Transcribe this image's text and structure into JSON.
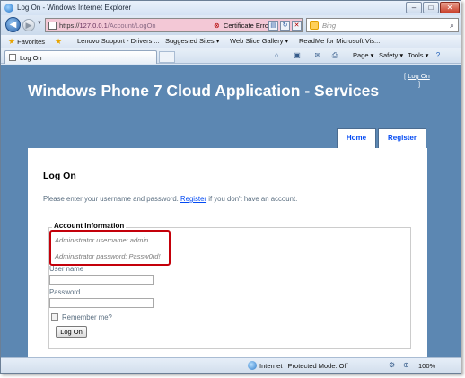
{
  "window": {
    "title": "Log On - Windows Internet Explorer",
    "min_label": "–",
    "max_label": "□",
    "close_label": "✕"
  },
  "address_bar": {
    "protocol": "https://",
    "host": "127.0.0.1",
    "path": "/Account/LogOn",
    "certificate_error": "Certificate Error",
    "search_placeholder": "Bing"
  },
  "favorites_bar": {
    "favorites_label": "Favorites",
    "items": [
      "Lenovo Support - Drivers ...",
      "Suggested Sites ▾",
      "Web Slice Gallery ▾",
      "ReadMe for Microsoft Vis..."
    ]
  },
  "tab": {
    "label": "Log On"
  },
  "command_bar": {
    "page": "Page ▾",
    "safety": "Safety ▾",
    "tools": "Tools ▾"
  },
  "site": {
    "title": "Windows Phone 7 Cloud Application - Services",
    "login_display": {
      "open": "[",
      "link": "Log On",
      "close": "]"
    },
    "menu": [
      "Home",
      "Register"
    ]
  },
  "logon": {
    "heading": "Log On",
    "intro_prefix": "Please enter your username and password.",
    "intro_link": "Register",
    "intro_suffix": "if you don't have an account.",
    "legend": "Account Information",
    "hint_username": "Administrator username: admin",
    "hint_password": "Administrator password: Passw0rd!",
    "username_label": "User name",
    "password_label": "Password",
    "username_value": "",
    "password_value": "",
    "remember_label": "Remember me?",
    "remember_checked": false,
    "submit_label": "Log On"
  },
  "status_bar": {
    "zone": "Internet | Protected Mode: Off",
    "zoom": "100%"
  },
  "colors": {
    "page_background": "#5c87b2",
    "link": "#034af3",
    "annotation": "#c4000a",
    "certificate_error_bar": "#f3c8d6"
  }
}
